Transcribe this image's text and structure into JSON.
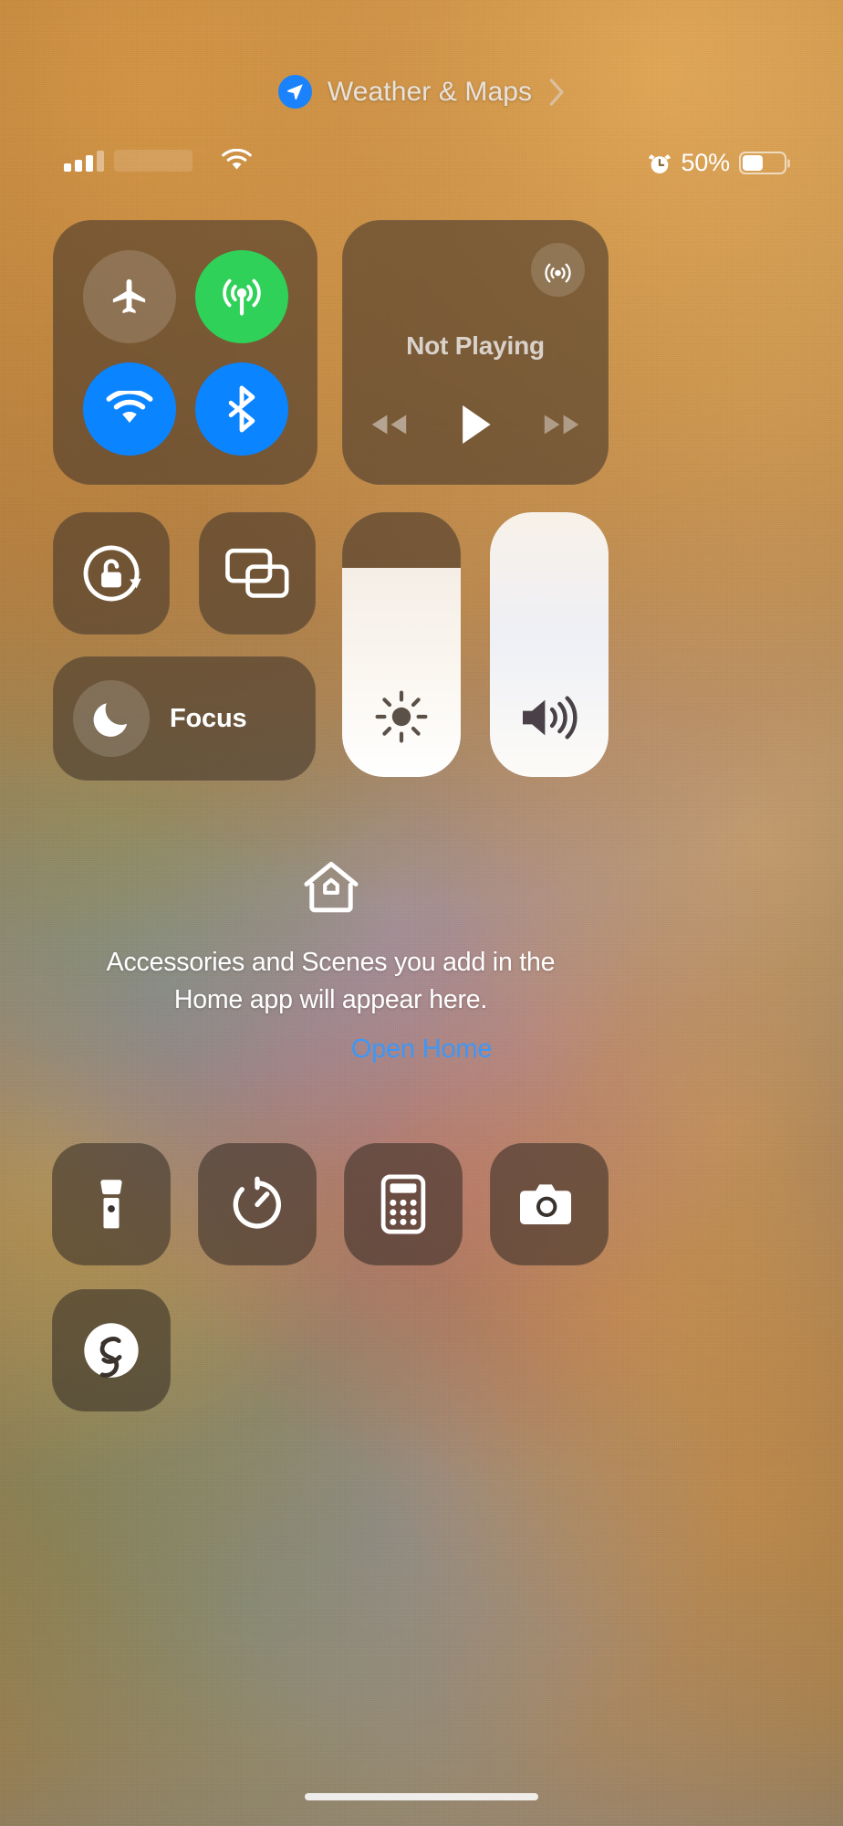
{
  "header": {
    "title": "Weather & Maps",
    "location_icon": "location-arrow-icon",
    "chevron_icon": "chevron-right-icon",
    "accent_blue": "#1a82fb"
  },
  "status_bar": {
    "signal_icon": "cellular-signal-icon",
    "signal_bars_filled": 3,
    "signal_bars_total": 4,
    "carrier_label": "",
    "wifi_icon": "wifi-icon",
    "alarm_icon": "alarm-clock-icon",
    "battery_percent": "50%",
    "battery_level": 50,
    "battery_icon": "battery-icon"
  },
  "connectivity": {
    "airplane_mode": {
      "label": "Airplane Mode",
      "icon": "airplane-icon",
      "state": "off",
      "color": "rgba(255,255,255,0.16)"
    },
    "cellular_data": {
      "label": "Cellular Data",
      "icon": "cellular-broadcast-icon",
      "state": "on",
      "color": "#2fd158"
    },
    "wifi": {
      "label": "Wi-Fi",
      "icon": "wifi-icon",
      "state": "on",
      "color": "#0a84ff"
    },
    "bluetooth": {
      "label": "Bluetooth",
      "icon": "bluetooth-icon",
      "state": "on",
      "color": "#0a84ff"
    }
  },
  "media": {
    "status_text": "Not Playing",
    "airplay_icon": "airplay-audio-icon",
    "rewind_icon": "rewind-icon",
    "play_icon": "play-icon",
    "forward_icon": "fast-forward-icon"
  },
  "toggles": {
    "rotation_lock": {
      "label": "Rotation Lock",
      "icon": "rotation-lock-unlocked-icon",
      "state": "off"
    },
    "screen_mirroring": {
      "label": "Screen Mirroring",
      "icon": "screen-mirroring-icon",
      "state": "off"
    },
    "focus": {
      "label": "Focus",
      "icon": "moon-icon",
      "state": "off"
    }
  },
  "sliders": {
    "brightness": {
      "label": "Brightness",
      "icon": "brightness-sun-icon",
      "value": 79
    },
    "volume": {
      "label": "Volume",
      "icon": "speaker-waves-icon",
      "value": 100
    }
  },
  "home": {
    "icon": "home-house-icon",
    "message": "Accessories and Scenes you add in the Home app will appear here.",
    "link_label": "Open Home",
    "link_color": "#3d97f7"
  },
  "apps": [
    {
      "name": "Flashlight",
      "icon": "flashlight-icon"
    },
    {
      "name": "Timer",
      "icon": "timer-icon"
    },
    {
      "name": "Calculator",
      "icon": "calculator-icon"
    },
    {
      "name": "Camera",
      "icon": "camera-icon"
    },
    {
      "name": "Shazam",
      "icon": "shazam-icon"
    }
  ]
}
